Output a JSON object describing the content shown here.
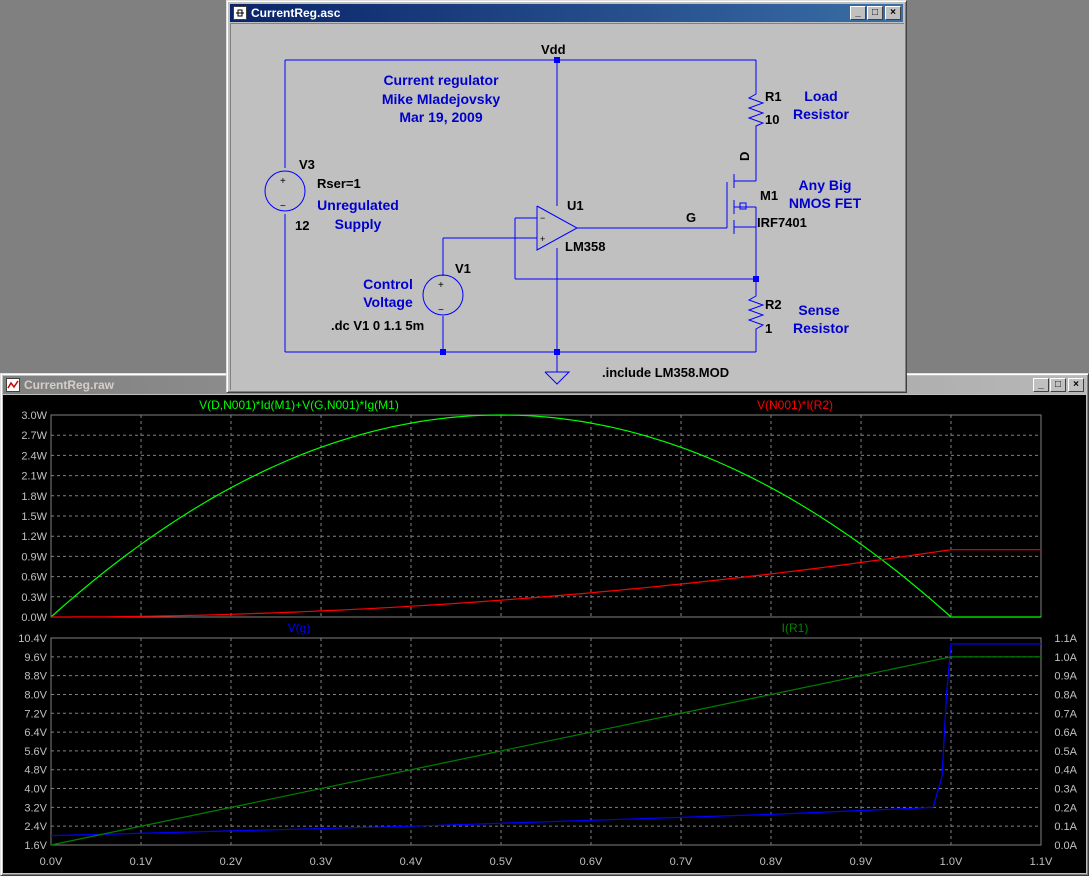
{
  "schematic_window": {
    "title": "CurrentReg.asc",
    "labels": {
      "vdd": "Vdd",
      "note_title": "Current regulator",
      "note_author": "Mike Mladejovsky",
      "note_date": "Mar 19, 2009",
      "v3_name": "V3",
      "v3_rser": "Rser=1",
      "v3_value": "12",
      "unregulated": "Unregulated",
      "supply": "Supply",
      "u1_name": "U1",
      "u1_value": "LM358",
      "g_label": "G",
      "d_label": "D",
      "r1_name": "R1",
      "r1_value": "10",
      "load": "Load",
      "resistor1": "Resistor",
      "m1_name": "M1",
      "m1_value": "IRF7401",
      "anybig": "Any Big",
      "nmos": "NMOS FET",
      "v1_name": "V1",
      "control": "Control",
      "voltage": "Voltage",
      "dc_cmd": ".dc V1 0 1.1 5m",
      "r2_name": "R2",
      "r2_value": "1",
      "sense": "Sense",
      "resistor2": "Resistor",
      "include": ".include LM358.MOD"
    }
  },
  "waveform_window": {
    "title": "CurrentReg.raw"
  },
  "colors": {
    "schematic_bg": "#c0c0c0",
    "wire": "#0000ff",
    "comment": "#0000cc",
    "plot_bg": "#000000",
    "grid": "#808080",
    "green": "#00ff00",
    "red": "#ff0000",
    "blue": "#0000ff",
    "darkgreen": "#008000"
  },
  "chart_data": [
    {
      "type": "line",
      "series": [
        {
          "name": "V(D,N001)*Id(M1)+V(G,N001)*Ig(M1)",
          "color": "#00ff00",
          "x": [
            0,
            0.1,
            0.2,
            0.3,
            0.4,
            0.5,
            0.6,
            0.7,
            0.8,
            0.9,
            0.98,
            1.0,
            1.1
          ],
          "y": [
            0,
            1.1,
            2.0,
            2.6,
            2.9,
            3.0,
            2.9,
            2.6,
            2.0,
            1.0,
            0.05,
            0,
            0
          ]
        },
        {
          "name": "V(N001)*I(R2)",
          "color": "#ff0000",
          "x": [
            0,
            0.08,
            0.2,
            0.3,
            0.4,
            0.5,
            0.6,
            0.7,
            0.8,
            0.9,
            0.99,
            1.0,
            1.1
          ],
          "y": [
            0,
            0,
            0.04,
            0.09,
            0.16,
            0.25,
            0.36,
            0.49,
            0.64,
            0.81,
            0.98,
            1.0,
            1.0
          ]
        }
      ],
      "yticks": [
        "3.0W",
        "2.7W",
        "2.4W",
        "2.1W",
        "1.8W",
        "1.5W",
        "1.2W",
        "0.9W",
        "0.6W",
        "0.3W",
        "0.0W"
      ],
      "ylim": [
        0,
        3.0
      ],
      "xlim": [
        0,
        1.1
      ],
      "grid": true
    },
    {
      "type": "line",
      "series": [
        {
          "name": "V(g)",
          "color": "#0000ff",
          "axis": "left",
          "x": [
            0,
            0.2,
            0.4,
            0.6,
            0.8,
            0.98,
            0.99,
            0.995,
            1.0,
            1.1
          ],
          "y": [
            2.0,
            2.2,
            2.4,
            2.65,
            2.9,
            3.2,
            4.5,
            8.0,
            10.15,
            10.15
          ]
        },
        {
          "name": "I(R1)",
          "color": "#008000",
          "axis": "right",
          "x": [
            0,
            0.99,
            1.0,
            1.1
          ],
          "y": [
            0,
            0.99,
            1.0,
            1.0
          ]
        }
      ],
      "yticks_left": [
        "10.4V",
        "9.6V",
        "8.8V",
        "8.0V",
        "7.2V",
        "6.4V",
        "5.6V",
        "4.8V",
        "4.0V",
        "3.2V",
        "2.4V",
        "1.6V"
      ],
      "yticks_right": [
        "1.1A",
        "1.0A",
        "0.9A",
        "0.8A",
        "0.7A",
        "0.6A",
        "0.5A",
        "0.4A",
        "0.3A",
        "0.2A",
        "0.1A",
        "0.0A"
      ],
      "ylim_left": [
        1.6,
        10.4
      ],
      "ylim_right": [
        0,
        1.1
      ],
      "xticks": [
        "0.0V",
        "0.1V",
        "0.2V",
        "0.3V",
        "0.4V",
        "0.5V",
        "0.6V",
        "0.7V",
        "0.8V",
        "0.9V",
        "1.0V",
        "1.1V"
      ],
      "xlim": [
        0,
        1.1
      ],
      "grid": true
    }
  ]
}
